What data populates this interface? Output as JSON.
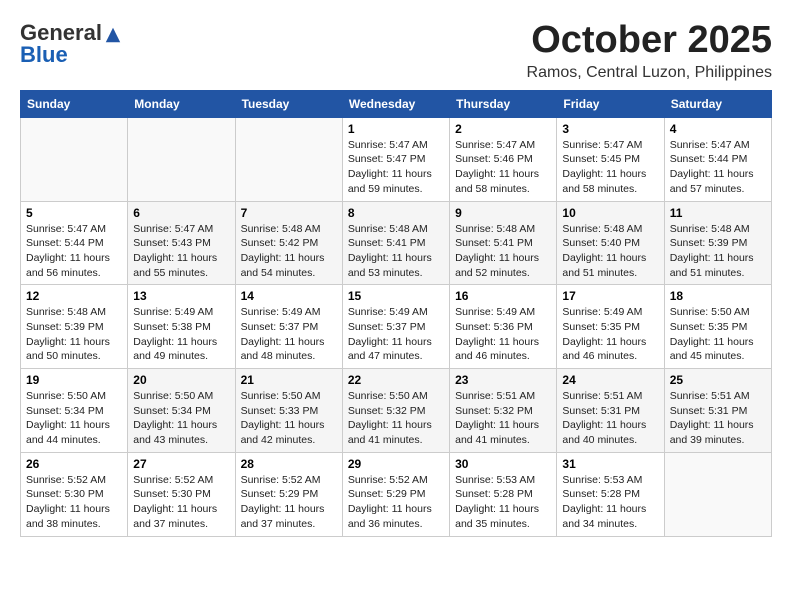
{
  "header": {
    "logo_general": "General",
    "logo_blue": "Blue",
    "month": "October 2025",
    "location": "Ramos, Central Luzon, Philippines"
  },
  "weekdays": [
    "Sunday",
    "Monday",
    "Tuesday",
    "Wednesday",
    "Thursday",
    "Friday",
    "Saturday"
  ],
  "weeks": [
    [
      {
        "day": "",
        "info": ""
      },
      {
        "day": "",
        "info": ""
      },
      {
        "day": "",
        "info": ""
      },
      {
        "day": "1",
        "info": "Sunrise: 5:47 AM\nSunset: 5:47 PM\nDaylight: 11 hours\nand 59 minutes."
      },
      {
        "day": "2",
        "info": "Sunrise: 5:47 AM\nSunset: 5:46 PM\nDaylight: 11 hours\nand 58 minutes."
      },
      {
        "day": "3",
        "info": "Sunrise: 5:47 AM\nSunset: 5:45 PM\nDaylight: 11 hours\nand 58 minutes."
      },
      {
        "day": "4",
        "info": "Sunrise: 5:47 AM\nSunset: 5:44 PM\nDaylight: 11 hours\nand 57 minutes."
      }
    ],
    [
      {
        "day": "5",
        "info": "Sunrise: 5:47 AM\nSunset: 5:44 PM\nDaylight: 11 hours\nand 56 minutes."
      },
      {
        "day": "6",
        "info": "Sunrise: 5:47 AM\nSunset: 5:43 PM\nDaylight: 11 hours\nand 55 minutes."
      },
      {
        "day": "7",
        "info": "Sunrise: 5:48 AM\nSunset: 5:42 PM\nDaylight: 11 hours\nand 54 minutes."
      },
      {
        "day": "8",
        "info": "Sunrise: 5:48 AM\nSunset: 5:41 PM\nDaylight: 11 hours\nand 53 minutes."
      },
      {
        "day": "9",
        "info": "Sunrise: 5:48 AM\nSunset: 5:41 PM\nDaylight: 11 hours\nand 52 minutes."
      },
      {
        "day": "10",
        "info": "Sunrise: 5:48 AM\nSunset: 5:40 PM\nDaylight: 11 hours\nand 51 minutes."
      },
      {
        "day": "11",
        "info": "Sunrise: 5:48 AM\nSunset: 5:39 PM\nDaylight: 11 hours\nand 51 minutes."
      }
    ],
    [
      {
        "day": "12",
        "info": "Sunrise: 5:48 AM\nSunset: 5:39 PM\nDaylight: 11 hours\nand 50 minutes."
      },
      {
        "day": "13",
        "info": "Sunrise: 5:49 AM\nSunset: 5:38 PM\nDaylight: 11 hours\nand 49 minutes."
      },
      {
        "day": "14",
        "info": "Sunrise: 5:49 AM\nSunset: 5:37 PM\nDaylight: 11 hours\nand 48 minutes."
      },
      {
        "day": "15",
        "info": "Sunrise: 5:49 AM\nSunset: 5:37 PM\nDaylight: 11 hours\nand 47 minutes."
      },
      {
        "day": "16",
        "info": "Sunrise: 5:49 AM\nSunset: 5:36 PM\nDaylight: 11 hours\nand 46 minutes."
      },
      {
        "day": "17",
        "info": "Sunrise: 5:49 AM\nSunset: 5:35 PM\nDaylight: 11 hours\nand 46 minutes."
      },
      {
        "day": "18",
        "info": "Sunrise: 5:50 AM\nSunset: 5:35 PM\nDaylight: 11 hours\nand 45 minutes."
      }
    ],
    [
      {
        "day": "19",
        "info": "Sunrise: 5:50 AM\nSunset: 5:34 PM\nDaylight: 11 hours\nand 44 minutes."
      },
      {
        "day": "20",
        "info": "Sunrise: 5:50 AM\nSunset: 5:34 PM\nDaylight: 11 hours\nand 43 minutes."
      },
      {
        "day": "21",
        "info": "Sunrise: 5:50 AM\nSunset: 5:33 PM\nDaylight: 11 hours\nand 42 minutes."
      },
      {
        "day": "22",
        "info": "Sunrise: 5:50 AM\nSunset: 5:32 PM\nDaylight: 11 hours\nand 41 minutes."
      },
      {
        "day": "23",
        "info": "Sunrise: 5:51 AM\nSunset: 5:32 PM\nDaylight: 11 hours\nand 41 minutes."
      },
      {
        "day": "24",
        "info": "Sunrise: 5:51 AM\nSunset: 5:31 PM\nDaylight: 11 hours\nand 40 minutes."
      },
      {
        "day": "25",
        "info": "Sunrise: 5:51 AM\nSunset: 5:31 PM\nDaylight: 11 hours\nand 39 minutes."
      }
    ],
    [
      {
        "day": "26",
        "info": "Sunrise: 5:52 AM\nSunset: 5:30 PM\nDaylight: 11 hours\nand 38 minutes."
      },
      {
        "day": "27",
        "info": "Sunrise: 5:52 AM\nSunset: 5:30 PM\nDaylight: 11 hours\nand 37 minutes."
      },
      {
        "day": "28",
        "info": "Sunrise: 5:52 AM\nSunset: 5:29 PM\nDaylight: 11 hours\nand 37 minutes."
      },
      {
        "day": "29",
        "info": "Sunrise: 5:52 AM\nSunset: 5:29 PM\nDaylight: 11 hours\nand 36 minutes."
      },
      {
        "day": "30",
        "info": "Sunrise: 5:53 AM\nSunset: 5:28 PM\nDaylight: 11 hours\nand 35 minutes."
      },
      {
        "day": "31",
        "info": "Sunrise: 5:53 AM\nSunset: 5:28 PM\nDaylight: 11 hours\nand 34 minutes."
      },
      {
        "day": "",
        "info": ""
      }
    ]
  ]
}
